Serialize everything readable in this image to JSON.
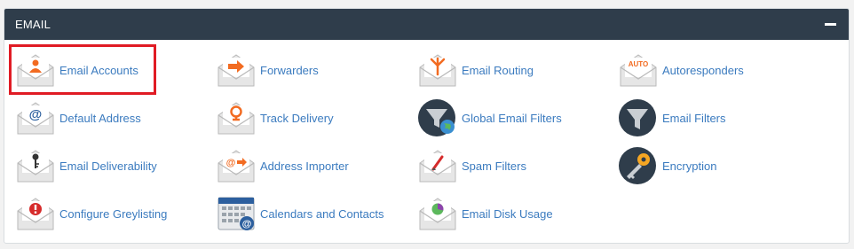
{
  "panel": {
    "title": "EMAIL"
  },
  "items": [
    {
      "label": "Email Accounts",
      "icon": "email-accounts-icon"
    },
    {
      "label": "Forwarders",
      "icon": "forwarders-icon"
    },
    {
      "label": "Email Routing",
      "icon": "email-routing-icon"
    },
    {
      "label": "Autoresponders",
      "icon": "autoresponders-icon",
      "icon_text": "AUTO"
    },
    {
      "label": "Default Address",
      "icon": "default-address-icon"
    },
    {
      "label": "Track Delivery",
      "icon": "track-delivery-icon"
    },
    {
      "label": "Global Email Filters",
      "icon": "global-email-filters-icon"
    },
    {
      "label": "Email Filters",
      "icon": "email-filters-icon"
    },
    {
      "label": "Email Deliverability",
      "icon": "email-deliverability-icon"
    },
    {
      "label": "Address Importer",
      "icon": "address-importer-icon"
    },
    {
      "label": "Spam Filters",
      "icon": "spam-filters-icon"
    },
    {
      "label": "Encryption",
      "icon": "encryption-icon"
    },
    {
      "label": "Configure Greylisting",
      "icon": "configure-greylisting-icon"
    },
    {
      "label": "Calendars and Contacts",
      "icon": "calendars-contacts-icon"
    },
    {
      "label": "Email Disk Usage",
      "icon": "email-disk-usage-icon"
    }
  ],
  "colors": {
    "header_bg": "#2f3d4b",
    "link": "#3b7bbf",
    "highlight": "#e01b24",
    "accent_orange": "#f26b21",
    "dark_circle": "#2f3d4b"
  }
}
